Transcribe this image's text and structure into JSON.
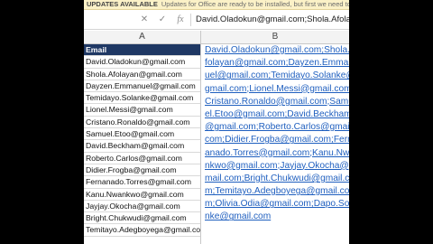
{
  "notice": {
    "title": "UPDATES AVAILABLE",
    "message": "Updates for Office are ready to be installed, but first we need to close some apps."
  },
  "formula_bar": {
    "cancel_symbol": "✕",
    "enter_symbol": "✓",
    "fx_label": "fx",
    "content": "David.Oladokun@gmail.com;Shola.Afolayan@gmail.com"
  },
  "columns": {
    "a": "A",
    "b": "B"
  },
  "column_a": {
    "header": "Email",
    "emails": [
      "David.Oladokun@gmail.com",
      "Shola.Afolayan@gmail.com",
      "Dayzen.Emmanuel@gmail.com",
      "Temidayo.Solanke@gmail.com",
      "Lionel.Messi@gmail.com",
      "Cristano.Ronaldo@gmail.com",
      "Samuel.Etoo@gmail.com",
      "David.Beckham@gmail.com",
      "Roberto.Carlos@gmail.com",
      "Didier.Frogba@gmail.com",
      "Fernanado.Torres@gmail.com",
      "Kanu.Nwankwo@gmail.com",
      "Jayjay.Okocha@gmail.com",
      "Bright.Chukwudi@gmail.com",
      "Temitayo.Adegboyega@gmail.com"
    ]
  },
  "column_b": {
    "lines": [
      "David.Oladokun@gmail.com;Shola.A",
      "folayan@gmail.com;Dayzen.Emman",
      "uel@gmail.com;Temidayo.Solanke@",
      "gmail.com;Lionel.Messi@gmail.com;",
      "Cristano.Ronaldo@gmail.com;Samu",
      "el.Etoo@gmail.com;David.Beckham",
      "@gmail.com;Roberto.Carlos@gmail.",
      "com;Didier.Frogba@gmail.com;Ferna",
      "anado.Torres@gmail.com;Kanu.Nwa",
      "nkwo@gmail.com;Jayjay.Okocha@g",
      "mail.com;Bright.Chukwudi@gmail.co",
      "m;Temitayo.Adegboyega@gmail.com",
      "m;Olivia.Odia@gmail.com;Dapo.Sola",
      "nke@gmail.com"
    ]
  }
}
